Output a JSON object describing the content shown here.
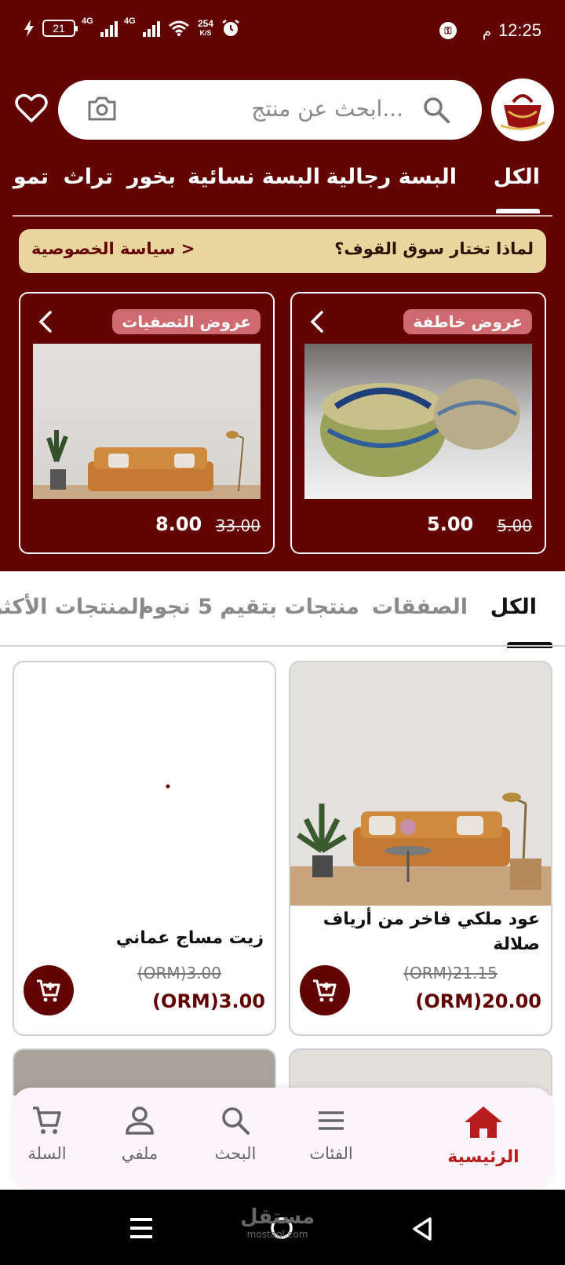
{
  "status": {
    "time": "12:25",
    "ampm": "م",
    "battery": "21",
    "net1": "4G",
    "net2": "4G",
    "speed_value": "254",
    "speed_unit": "K/S"
  },
  "header": {
    "search_placeholder": "ابحث عن منتج..."
  },
  "categories": [
    "الكل",
    "البسة رجالية",
    "البسة نسائية",
    "بخور",
    "تراث",
    "تمو"
  ],
  "info_bar": {
    "why": "لماذا تختار سوق القوف؟",
    "privacy": "سياسة الخصوصية >"
  },
  "promos": [
    {
      "tag": "عروض خاطفة",
      "price": "5.00",
      "old_price": "5.00"
    },
    {
      "tag": "عروض التصفيات",
      "price": "8.00",
      "old_price": "33.00"
    }
  ],
  "product_tabs": [
    "الكل",
    "الصفقات",
    "منتجات بتقيم 5 نجوم",
    "المنتجات الأكثر"
  ],
  "products": [
    {
      "name": "عود ملكي فاخر من أرياف صلالة",
      "old_price": "(ORM)21.15",
      "price": "(ORM)20.00"
    },
    {
      "name": "زيت مساج عماني",
      "old_price": "(ORM)3.00",
      "price": "(ORM)3.00"
    }
  ],
  "bottom_nav": {
    "home": "الرئيسية",
    "categories": "الفئات",
    "search": "البحث",
    "profile": "ملفي",
    "cart": "السلة"
  },
  "watermark": {
    "main": "مستقل",
    "sub": "mostaql.com"
  },
  "colors": {
    "brand": "#620301",
    "accent": "#b81d1d",
    "gold": "#e9d59e",
    "tag": "#cf6a70"
  }
}
